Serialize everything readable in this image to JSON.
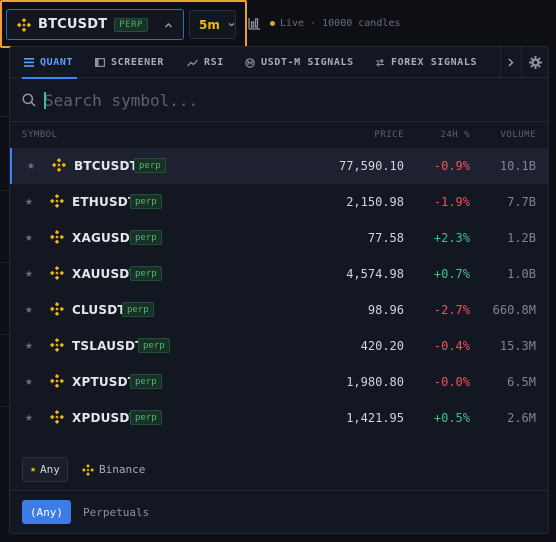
{
  "topbar": {
    "symbol": "BTCUSDT",
    "symbol_badge": "PERP",
    "timeframe": "5m",
    "live_status": "Live · 10000 candles"
  },
  "tabs": [
    {
      "label": "QUANT",
      "icon": "list-icon",
      "active": true
    },
    {
      "label": "SCREENER",
      "icon": "screener-icon",
      "active": false
    },
    {
      "label": "RSI",
      "icon": "trend-icon",
      "active": false
    },
    {
      "label": "USDT-M SIGNALS",
      "icon": "signal-icon",
      "active": false
    },
    {
      "label": "FOREX SIGNALS",
      "icon": "exchange-icon",
      "active": false
    }
  ],
  "search": {
    "placeholder": "Search symbol..."
  },
  "columns": {
    "symbol": "SYMBOL",
    "price": "PRICE",
    "change": "24H %",
    "volume": "VOLUME"
  },
  "rows": [
    {
      "symbol": "BTCUSDT",
      "badge": "perp",
      "price": "77,590.10",
      "change": "-0.9%",
      "volume": "10.1B"
    },
    {
      "symbol": "ETHUSDT",
      "badge": "perp",
      "price": "2,150.98",
      "change": "-1.9%",
      "volume": "7.7B"
    },
    {
      "symbol": "XAGUSDT",
      "badge": "perp",
      "price": "77.58",
      "change": "+2.3%",
      "volume": "1.2B"
    },
    {
      "symbol": "XAUUSDT",
      "badge": "perp",
      "price": "4,574.98",
      "change": "+0.7%",
      "volume": "1.0B"
    },
    {
      "symbol": "CLUSDT",
      "badge": "perp",
      "price": "98.96",
      "change": "-2.7%",
      "volume": "660.8M"
    },
    {
      "symbol": "TSLAUSDT",
      "badge": "perp",
      "price": "420.20",
      "change": "-0.4%",
      "volume": "15.3M"
    },
    {
      "symbol": "XPTUSDT",
      "badge": "perp",
      "price": "1,980.80",
      "change": "-0.0%",
      "volume": "6.5M"
    },
    {
      "symbol": "XPDUSDT",
      "badge": "perp",
      "price": "1,421.95",
      "change": "+0.5%",
      "volume": "2.6M"
    }
  ],
  "exchange_filter": {
    "any_label": "Any",
    "binance_label": "Binance"
  },
  "type_filter": {
    "any_label": "(Any)",
    "perpetuals_label": "Perpetuals"
  },
  "colors": {
    "accent": "#3d82f6",
    "binance": "#f0b90b",
    "negative": "#f0515b",
    "positive": "#3cc08e",
    "highlight": "#f0a030"
  }
}
